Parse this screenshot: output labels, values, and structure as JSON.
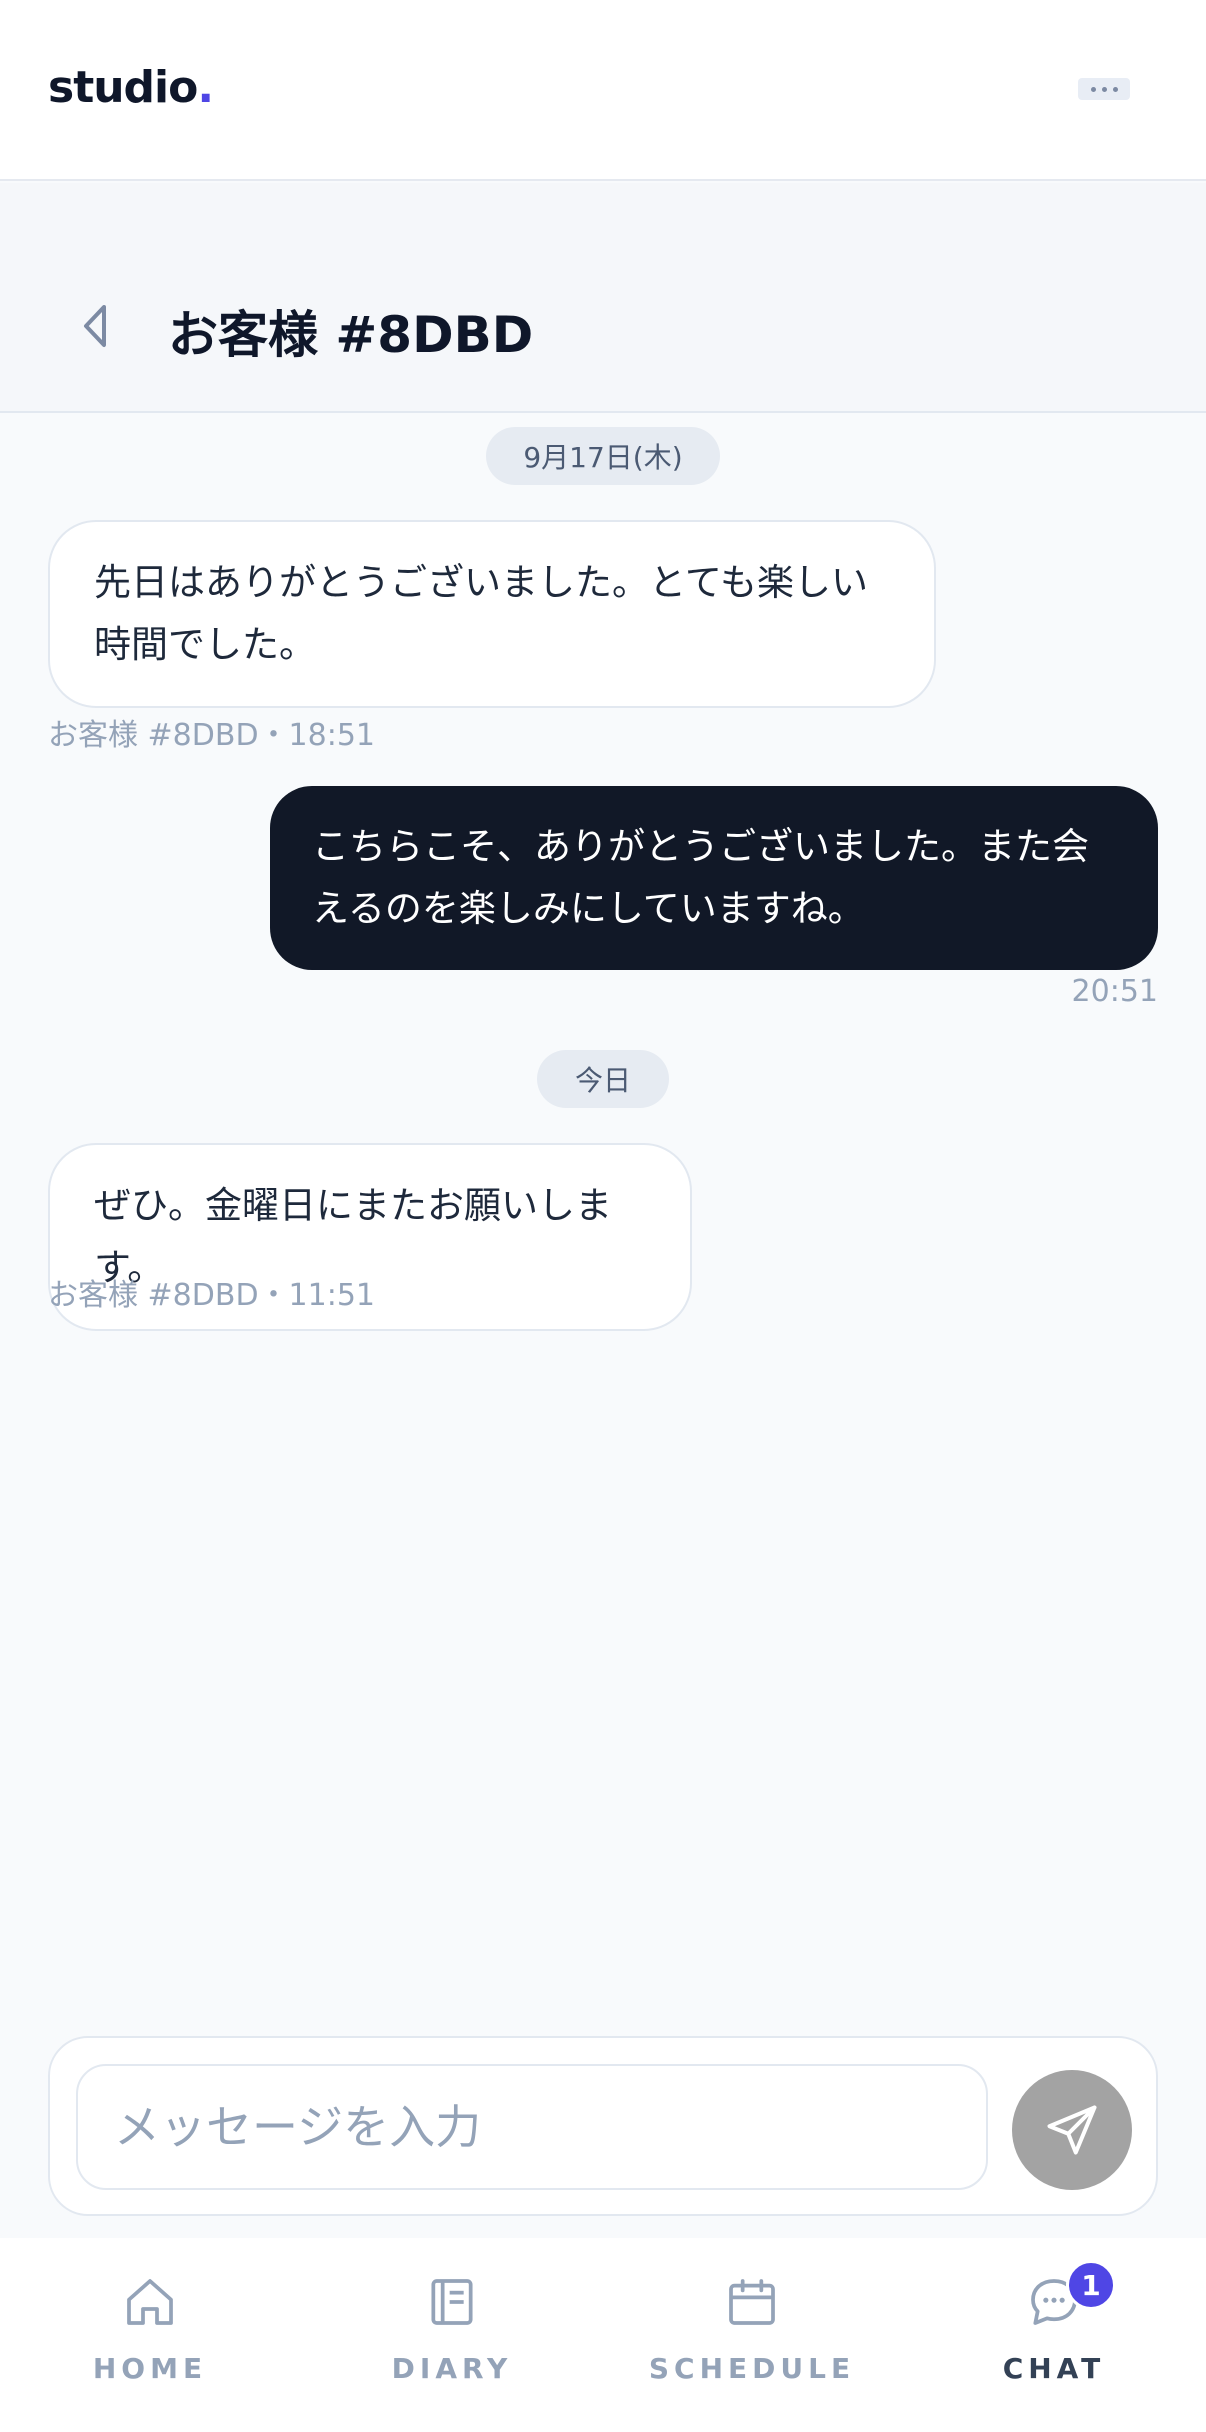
{
  "app": {
    "logo_text": "studio",
    "logo_dot": ".",
    "accent_color": "#4f46e5"
  },
  "conversation": {
    "title": "お客様 #8DBD"
  },
  "messages": [
    {
      "type": "date",
      "label": "9月17日(木)"
    },
    {
      "type": "incoming",
      "text": "先日はありがとうございました。とても楽しい時間でした。",
      "meta": "お客様 #8DBD・18:51"
    },
    {
      "type": "outgoing",
      "text": "こちらこそ、ありがとうございました。また会えるのを楽しみにしていますね。",
      "meta": "20:51"
    },
    {
      "type": "date",
      "label": "今日"
    },
    {
      "type": "incoming",
      "text": "ぜひ。金曜日にまたお願いします。",
      "meta": "お客様 #8DBD・11:51"
    }
  ],
  "composer": {
    "placeholder": "メッセージを入力",
    "value": ""
  },
  "nav": {
    "items": [
      {
        "label": "HOME",
        "icon": "home-icon"
      },
      {
        "label": "DIARY",
        "icon": "diary-icon"
      },
      {
        "label": "SCHEDULE",
        "icon": "calendar-icon"
      },
      {
        "label": "CHAT",
        "icon": "chat-icon",
        "active": true,
        "badge": "1"
      }
    ]
  }
}
